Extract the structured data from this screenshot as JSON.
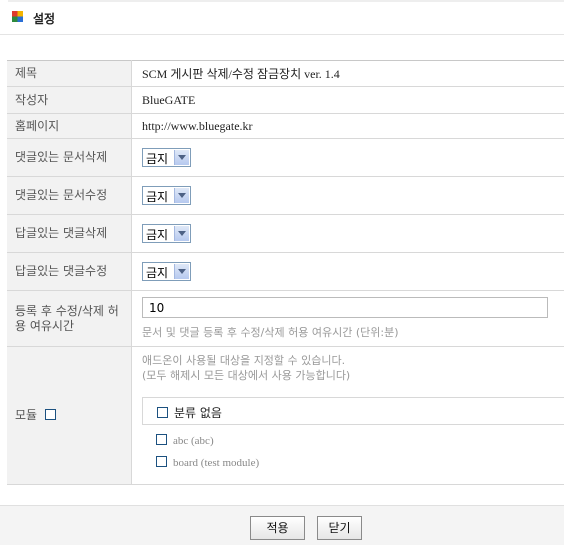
{
  "header": {
    "title": "설정"
  },
  "rows": {
    "title": {
      "label": "제목",
      "value": "SCM 게시판 삭제/수정 잠금장치 ver. 1.4"
    },
    "author": {
      "label": "작성자",
      "value": "BlueGATE"
    },
    "homepage": {
      "label": "홈페이지",
      "value": "http://www.bluegate.kr"
    },
    "commented_doc_delete": {
      "label": "댓글있는 문서삭제",
      "value": "금지"
    },
    "commented_doc_edit": {
      "label": "댓글있는 문서수정",
      "value": "금지"
    },
    "replied_comment_delete": {
      "label": "답글있는 댓글삭제",
      "value": "금지"
    },
    "replied_comment_edit": {
      "label": "답글있는 댓글수정",
      "value": "금지"
    },
    "grace_time": {
      "label": "등록 후 수정/삭제 허용 여유시간",
      "value": "10",
      "description": "문서 및 댓글 등록 후 수정/삭제 허용 여유시간 (단위:분)"
    },
    "module": {
      "label": "모듈",
      "note_line1": "애드온이 사용될 대상을 지정할 수 있습니다.",
      "note_line2": "(모두 해제시 모든 대상에서 사용 가능합니다)",
      "no_category": "분류 없음",
      "items": [
        "abc (abc)",
        "board (test module)"
      ]
    }
  },
  "footer": {
    "apply_label": "적용",
    "close_label": "닫기"
  },
  "colors": {
    "label_bg": "#f2f2f2",
    "border": "#d8d8d8",
    "checkbox_border": "#1c5180"
  }
}
